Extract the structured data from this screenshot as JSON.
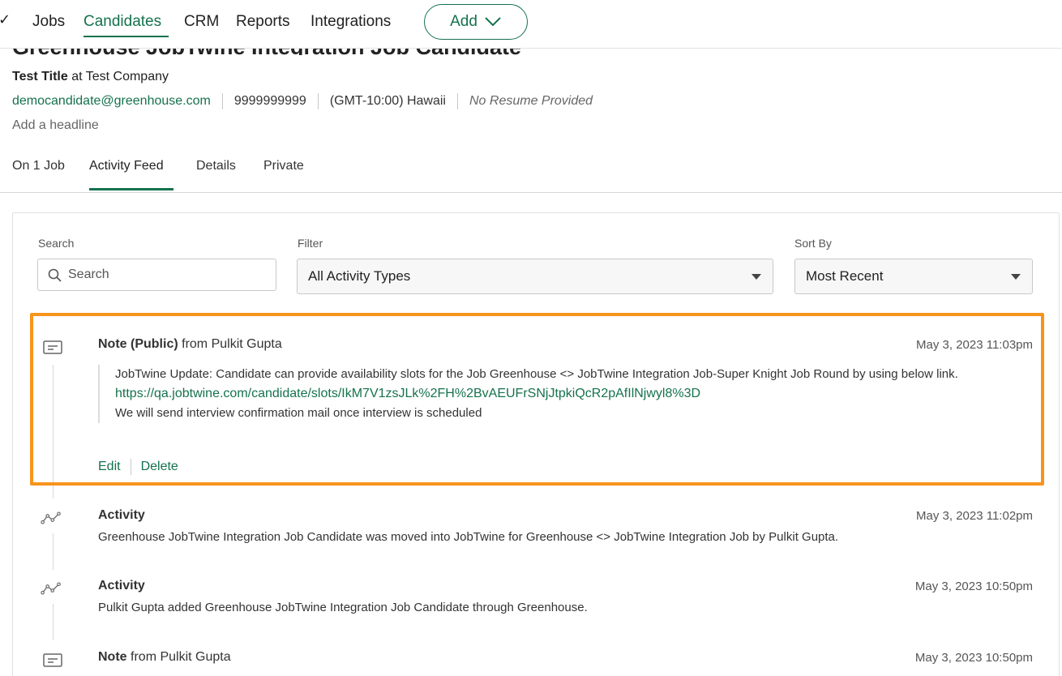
{
  "nav": {
    "items": [
      {
        "label": "Jobs",
        "active": false
      },
      {
        "label": "Candidates",
        "active": true
      },
      {
        "label": "CRM",
        "active": false
      },
      {
        "label": "Reports",
        "active": false
      },
      {
        "label": "Integrations",
        "active": false
      }
    ],
    "add_label": "Add"
  },
  "candidate": {
    "name": "Greenhouse JobTwine Integration Job Candidate",
    "title": "Test Title",
    "at": "at",
    "company": "Test Company",
    "email": "democandidate@greenhouse.com",
    "phone": "9999999999",
    "timezone": "(GMT-10:00) Hawaii",
    "resume": "No Resume Provided",
    "headline_placeholder": "Add a headline"
  },
  "tabs": [
    {
      "label": "On 1 Job",
      "active": false
    },
    {
      "label": "Activity Feed",
      "active": true
    },
    {
      "label": "Details",
      "active": false
    },
    {
      "label": "Private",
      "active": false
    }
  ],
  "controls": {
    "search_label": "Search",
    "search_placeholder": "Search",
    "filter_label": "Filter",
    "filter_value": "All Activity Types",
    "sort_label": "Sort By",
    "sort_value": "Most Recent"
  },
  "feed": [
    {
      "type": "note",
      "icon": "note-icon",
      "title_bold": "Note (Public)",
      "title_rest": "from Pulkit Gupta",
      "time": "May 3, 2023 11:03pm",
      "body_line1": "JobTwine Update: Candidate can provide availability slots for the Job Greenhouse <> JobTwine Integration Job-Super Knight Job Round by using below link.",
      "link": "https://qa.jobtwine.com/candidate/slots/IkM7V1zsJLk%2FH%2BvAEUFrSNjJtpkiQcR2pAfIlNjwyl8%3D",
      "body_line2": "We will send interview confirmation mail once interview is scheduled",
      "edit_label": "Edit",
      "delete_label": "Delete"
    },
    {
      "type": "activity",
      "icon": "activity-icon",
      "title_bold": "Activity",
      "time": "May 3, 2023 11:02pm",
      "body": "Greenhouse JobTwine Integration Job Candidate was moved into JobTwine for Greenhouse <> JobTwine Integration Job by Pulkit Gupta."
    },
    {
      "type": "activity",
      "icon": "activity-icon",
      "title_bold": "Activity",
      "time": "May 3, 2023 10:50pm",
      "body": "Pulkit Gupta added Greenhouse JobTwine Integration Job Candidate through Greenhouse."
    },
    {
      "type": "note",
      "icon": "note-icon",
      "title_bold": "Note",
      "title_rest": "from Pulkit Gupta",
      "time": "May 3, 2023 10:50pm"
    }
  ],
  "colors": {
    "brand_green": "#15724d",
    "highlight_orange": "#f7941d"
  }
}
